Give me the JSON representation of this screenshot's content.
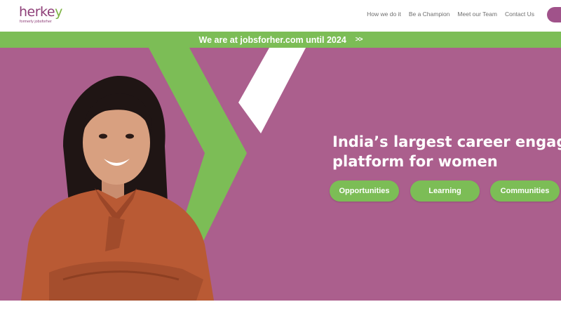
{
  "logo": {
    "name": "herkey",
    "tagline": "formerly jobsforher"
  },
  "nav": {
    "items": [
      "How we do it",
      "Be a Champion",
      "Meet our Team",
      "Contact Us"
    ]
  },
  "banner": {
    "text": "We are at jobsforher.com until 2024",
    "arrows": ">>"
  },
  "hero": {
    "headline_line1": "India’s largest career engage",
    "headline_line2": "platform for women",
    "buttons": [
      "Opportunities",
      "Learning",
      "Communities"
    ]
  },
  "colors": {
    "brand_purple": "#8e3f78",
    "hero_bg": "#ab5f8d",
    "accent_green": "#7cbd56",
    "white": "#ffffff"
  }
}
